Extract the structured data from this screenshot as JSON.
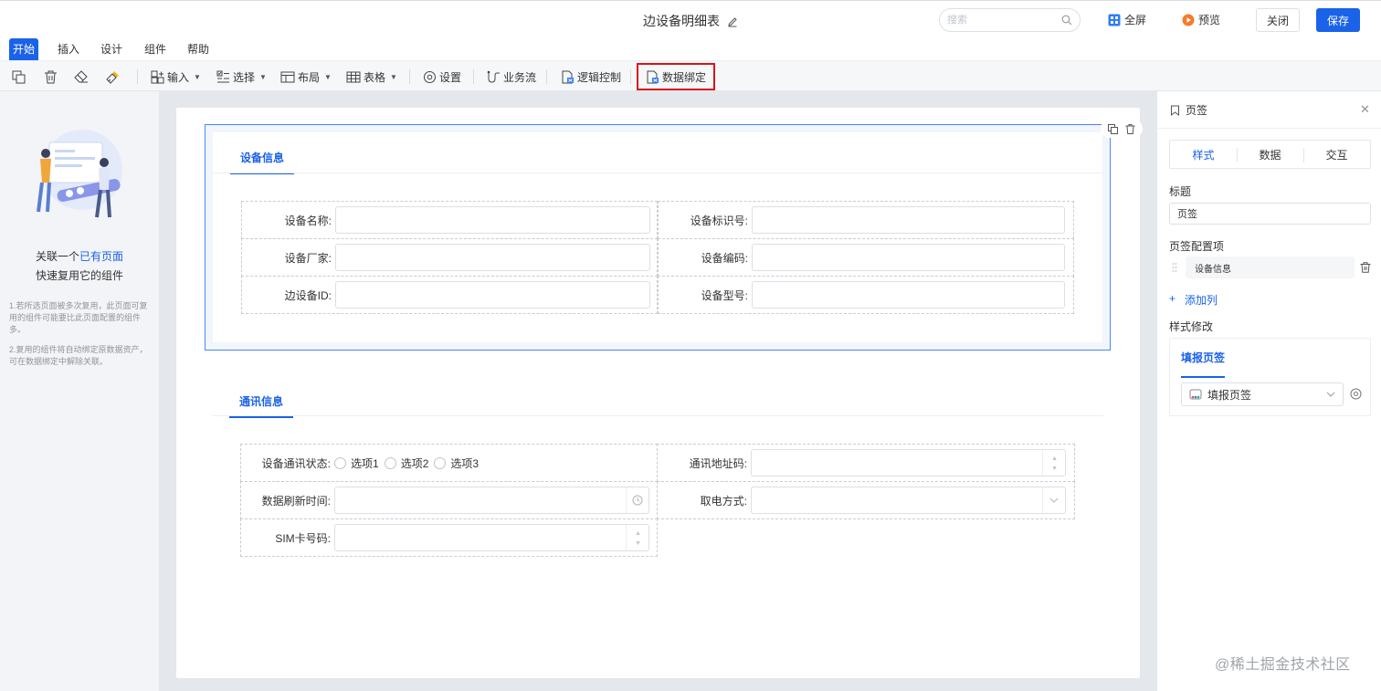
{
  "header": {
    "title": "边设备明细表",
    "search_placeholder": "搜索",
    "fullscreen_label": "全屏",
    "preview_label": "预览",
    "close_label": "关闭",
    "save_label": "保存"
  },
  "menu": {
    "tabs": [
      {
        "label": "开始",
        "active": true
      },
      {
        "label": "插入"
      },
      {
        "label": "设计"
      },
      {
        "label": "组件"
      },
      {
        "label": "帮助"
      }
    ]
  },
  "toolbar": {
    "input_label": "输入",
    "select_label": "选择",
    "layout_label": "布局",
    "table_label": "表格",
    "settings_label": "设置",
    "workflow_label": "业务流",
    "logic_label": "逻辑控制",
    "databind_label": "数据绑定"
  },
  "left_panel": {
    "line1_prefix": "关联一个",
    "line1_link": "已有页面",
    "line2": "快速复用它的组件",
    "note1": "1.若所选页面被多次复用，此页面可复用的组件可能要比此页面配置的组件多。",
    "note2": "2.复用的组件将自动绑定原数据资产，可在数据绑定中解除关联。"
  },
  "canvas": {
    "section1": {
      "tab": "设备信息",
      "fields": {
        "name": "设备名称:",
        "ident": "设备标识号:",
        "vendor": "设备厂家:",
        "code": "设备编码:",
        "edge_id": "边设备ID:",
        "model": "设备型号:"
      }
    },
    "section2": {
      "tab": "通讯信息",
      "fields": {
        "comm_status": "设备通讯状态:",
        "address": "通讯地址码:",
        "refresh": "数据刷新时间:",
        "power": "取电方式:",
        "sim": "SIM卡号码:"
      },
      "options": [
        "选项1",
        "选项2",
        "选项3"
      ]
    }
  },
  "right_panel": {
    "title": "页签",
    "tabs": [
      "样式",
      "数据",
      "交互"
    ],
    "title_label": "标题",
    "title_value": "页签",
    "config_label": "页签配置项",
    "config_item": "设备信息",
    "add_col_plus": "+",
    "add_col": "添加列",
    "style_mod_label": "样式修改",
    "style_tab": "填报页签",
    "style_select": "填报页签"
  },
  "watermark": "@稀土掘金技术社区",
  "colors": {
    "primary": "#1a62e8",
    "highlight": "#d9141b",
    "panel_bg": "#f3f4f7"
  }
}
